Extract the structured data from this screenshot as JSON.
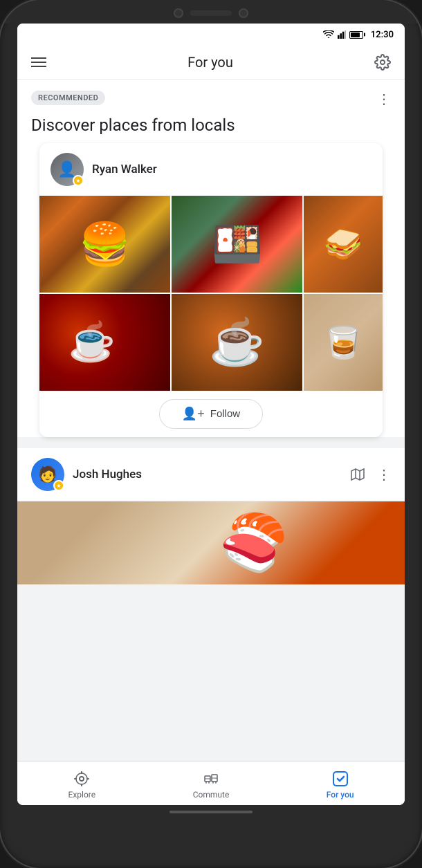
{
  "phone": {
    "time": "12:30"
  },
  "header": {
    "title": "For you",
    "menu_label": "Menu",
    "settings_label": "Settings"
  },
  "section": {
    "badge": "RECOMMENDED",
    "title": "Discover places from locals",
    "more_label": "More options"
  },
  "user_card": {
    "name": "Ryan Walker",
    "follow_label": "Follow",
    "photos": [
      {
        "type": "burger",
        "alt": "Burger and fries"
      },
      {
        "type": "sushi",
        "alt": "Sushi platter"
      },
      {
        "type": "sandwich",
        "alt": "Sandwich"
      },
      {
        "type": "coffee-red",
        "alt": "Red cup coffee"
      },
      {
        "type": "latte",
        "alt": "Latte art"
      },
      {
        "type": "glass",
        "alt": "Drink glass"
      }
    ]
  },
  "user_row": {
    "name": "Josh Hughes"
  },
  "bottom_nav": {
    "items": [
      {
        "id": "explore",
        "label": "Explore",
        "icon": "location-pin",
        "active": false
      },
      {
        "id": "commute",
        "label": "Commute",
        "icon": "commute",
        "active": false
      },
      {
        "id": "for-you",
        "label": "For you",
        "icon": "for-you-star",
        "active": true
      }
    ]
  }
}
